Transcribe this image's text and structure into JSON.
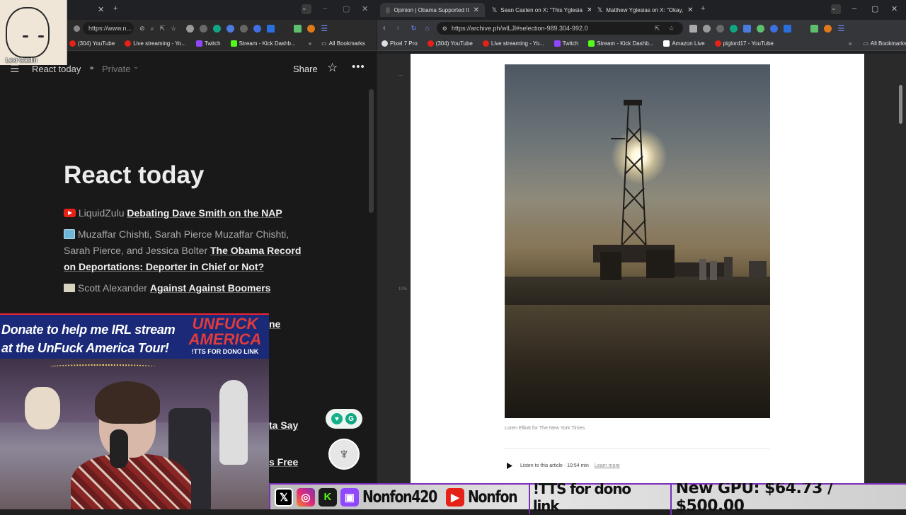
{
  "left_browser": {
    "url": "https://www.n...",
    "bookmarks": [
      "(304) YouTube",
      "Live streaming - Yo...",
      "Twitch",
      "Stream - Kick Dashb..."
    ],
    "all_bookmarks": "All Bookmarks"
  },
  "notion": {
    "breadcrumb": "React today",
    "privacy": "Private",
    "share_label": "Share",
    "page_title": "React today",
    "entries": [
      {
        "icon": "youtube-icon",
        "author": "LiquidZulu",
        "title": "Debating Dave Smith on the NAP"
      },
      {
        "icon": "image-icon",
        "author": "Muzaffar Chishti, Sarah Pierce Muzaffar Chishti, Sarah Pierce, and Jessica Bolter",
        "title": "The Obama Record on Deportations: Deporter in Chief or Not?"
      },
      {
        "icon": "document-icon",
        "author": "Scott Alexander",
        "title": "Against Against Boomers"
      }
    ],
    "partial_1": "ne",
    "partial_2": "ta Say",
    "partial_3": "s Free"
  },
  "overlay": {
    "avatar_label": "Lexi Gaslin",
    "donate_line1": "Donate to help me  IRL stream",
    "donate_line2": "at the UnFuck America Tour!",
    "unfuck_line1": "UNFUCK",
    "unfuck_line2": "AMERICA",
    "tts_note": "!TTS FOR DONO LINK",
    "social_handle_1": "Nonfon420",
    "social_handle_2": "Nonfon",
    "tts_dono": "!TTS for dono link",
    "gpu_goal": "New GPU: $64.73 / $500.00"
  },
  "right_browser": {
    "tabs": [
      {
        "label": "Opinion | Obama Supported It",
        "active": true
      },
      {
        "label": "Sean Casten on X: \"This Yglesia",
        "active": false
      },
      {
        "label": "Matthew Yglesias on X: \"Okay,",
        "active": false
      }
    ],
    "url": "https://archive.ph/wlLJl#selection-989.304-992.0",
    "bookmarks": [
      "Pixel 7 Pro",
      "(304) YouTube",
      "Live streaming - Yo...",
      "Twitch",
      "Stream - Kick Dashb...",
      "Amazon Live",
      "piglord17 - YouTube"
    ],
    "all_bookmarks": "All Bookmarks",
    "margin_mark_1": "—",
    "margin_mark_2": "10%"
  },
  "article": {
    "photo_alt": "Oil drilling rig silhouetted against the sun",
    "caption": "Loren Elliott for The New York Times",
    "listen_label": "Listen to this article · 10:54 min",
    "learn_more": "Learn more"
  },
  "colors": {
    "youtube_red": "#e62117",
    "twitch_purple": "#9146ff",
    "kick_green": "#53fc18",
    "x_black": "#000000"
  }
}
